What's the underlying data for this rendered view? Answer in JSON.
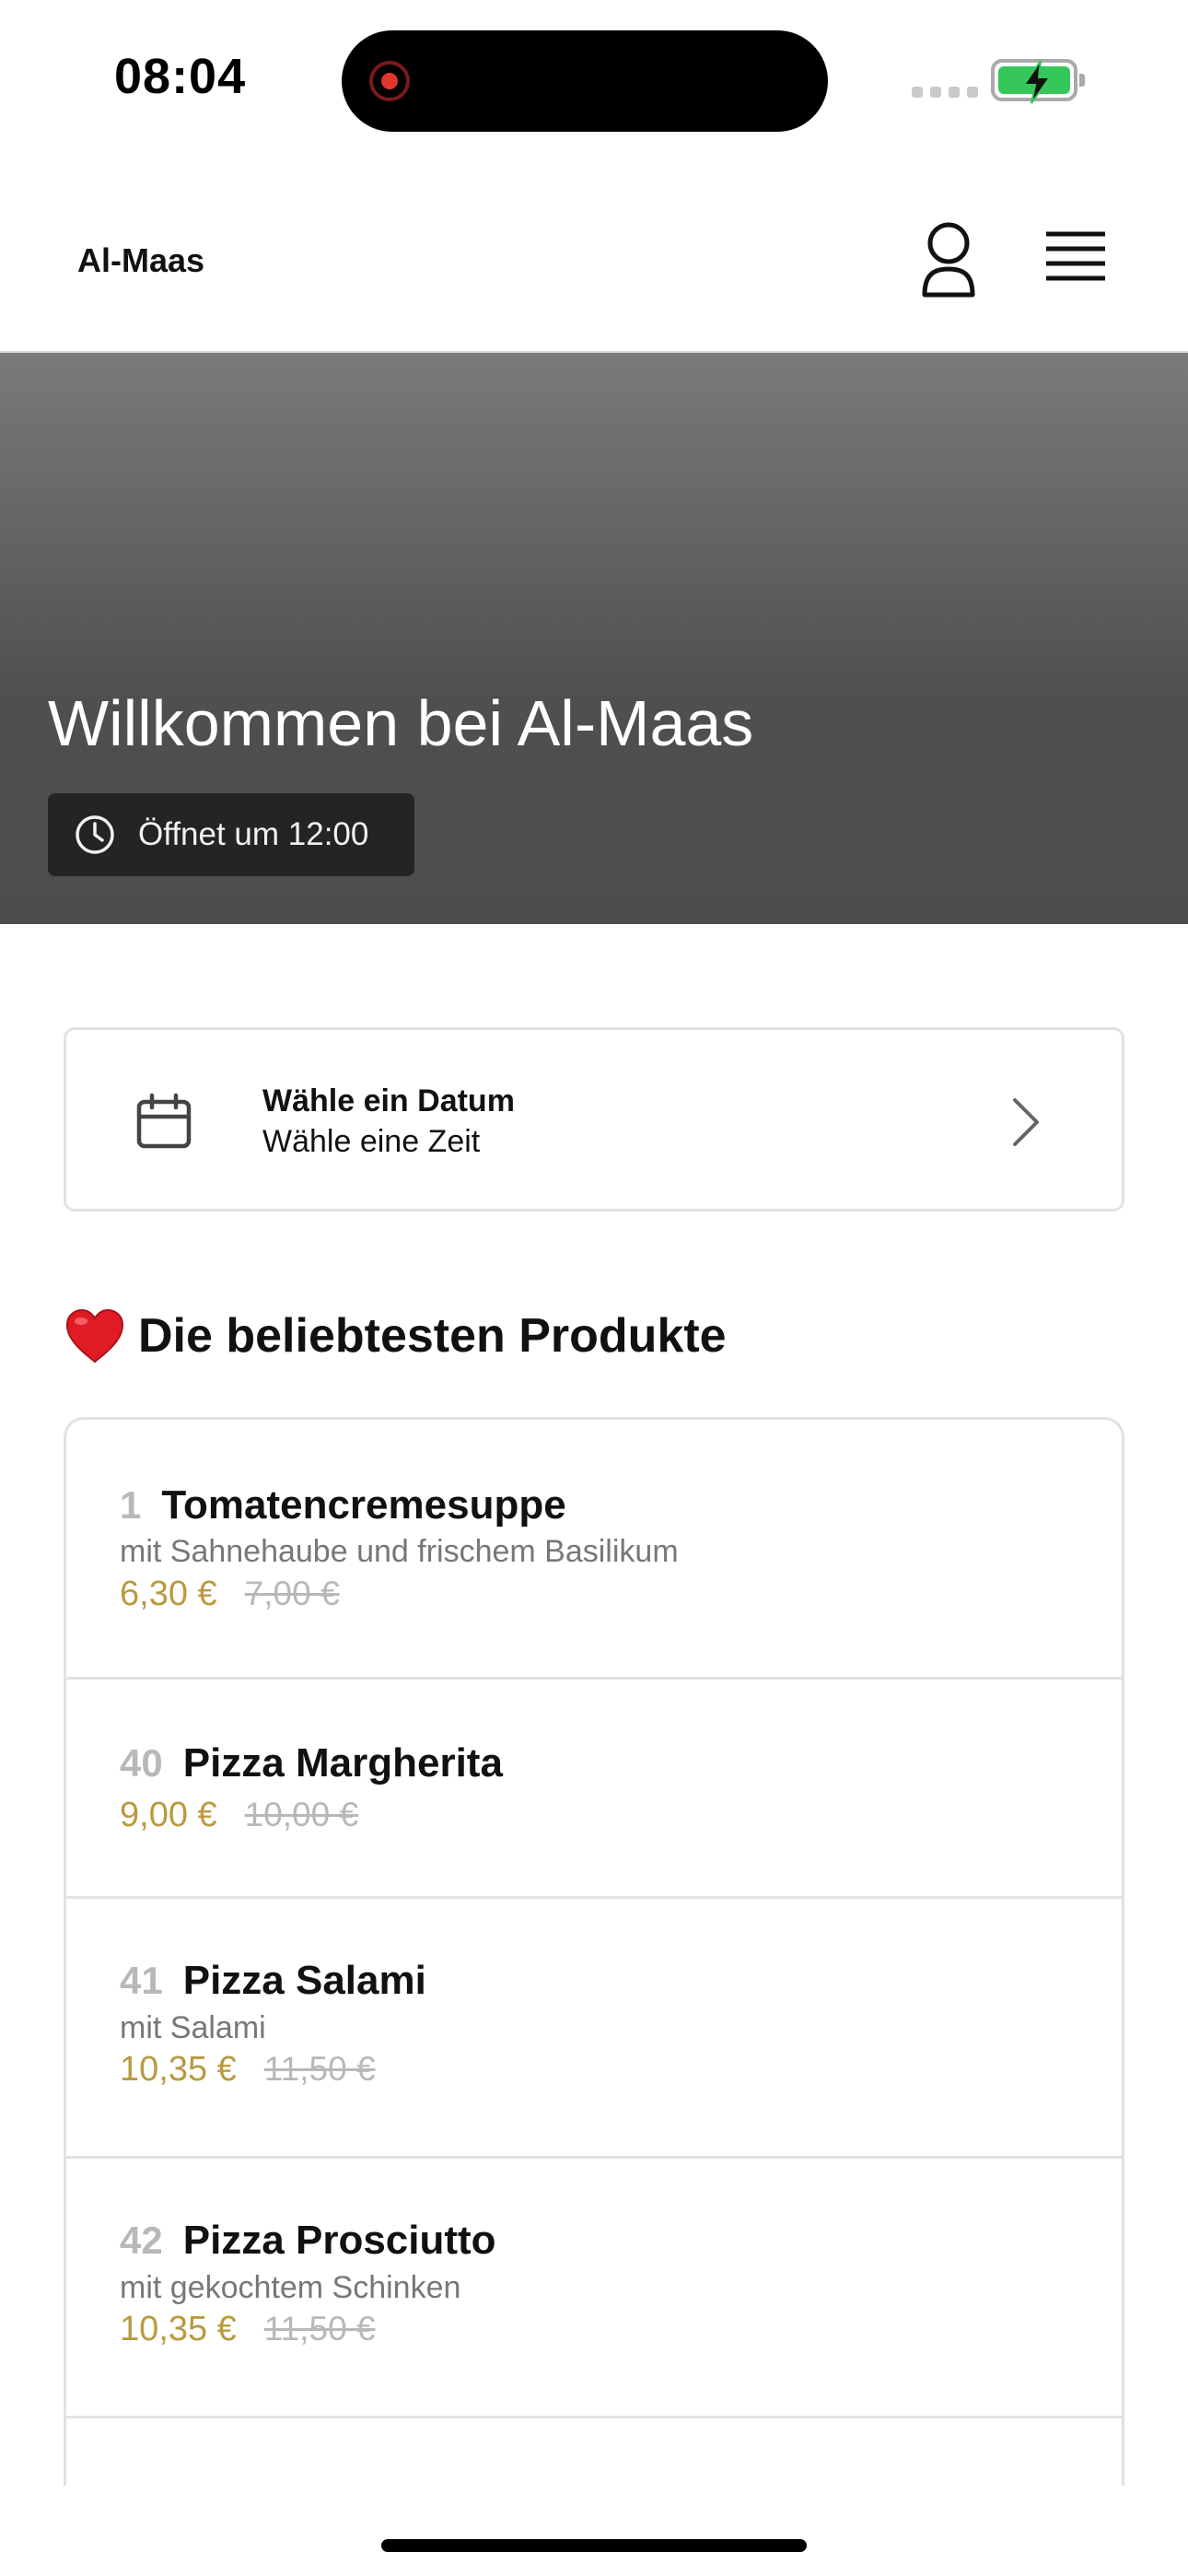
{
  "status_bar": {
    "time": "08:04",
    "recording_indicator_color": "#e0362f",
    "battery_color": "#35c759"
  },
  "header": {
    "brand": "Al-Maas",
    "icons": [
      "user-icon",
      "menu-icon"
    ]
  },
  "hero": {
    "title": "Willkommen bei Al-Maas",
    "opening_hours": "Öffnet um 12:00",
    "icon": "clock-icon"
  },
  "date_picker": {
    "date_label": "Wähle ein Datum",
    "time_label": "Wähle eine Zeit",
    "icons": [
      "calendar-icon",
      "chevron-right-icon"
    ]
  },
  "popular": {
    "title": "Die beliebtesten Produkte",
    "icon": "heart-icon",
    "products": [
      {
        "number": "1",
        "name": "Tomatencremesuppe",
        "description": "mit Sahnehaube und frischem Basilikum",
        "price": "6,30 €",
        "old_price": "7,00 €"
      },
      {
        "number": "40",
        "name": "Pizza Margherita",
        "description": "",
        "price": "9,00 €",
        "old_price": "10,00 €"
      },
      {
        "number": "41",
        "name": "Pizza Salami",
        "description": "mit Salami",
        "price": "10,35 €",
        "old_price": "11,50 €"
      },
      {
        "number": "42",
        "name": "Pizza Prosciutto",
        "description": "mit gekochtem Schinken",
        "price": "10,35 €",
        "old_price": "11,50 €"
      }
    ]
  },
  "colors": {
    "price": "#b99a3e",
    "old_price": "#b8b8b8",
    "hero_badge": "#242424"
  }
}
